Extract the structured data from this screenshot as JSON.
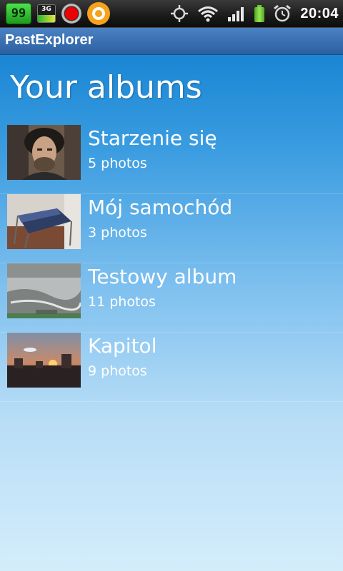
{
  "status_bar": {
    "notification_badge": "99",
    "network_badge": "3G",
    "icons": [
      "gps-icon",
      "wifi-icon",
      "signal-icon",
      "battery-icon",
      "alarm-icon"
    ],
    "clock": "20:04"
  },
  "app": {
    "title": "PastExplorer",
    "accent_color": "#2b5fa2"
  },
  "page": {
    "heading": "Your albums"
  },
  "albums": [
    {
      "name": "Starzenie się",
      "count": "5 photos"
    },
    {
      "name": "Mój samochód",
      "count": "3 photos"
    },
    {
      "name": "Testowy album",
      "count": "11 photos"
    },
    {
      "name": "Kapitol",
      "count": "9 photos"
    }
  ]
}
